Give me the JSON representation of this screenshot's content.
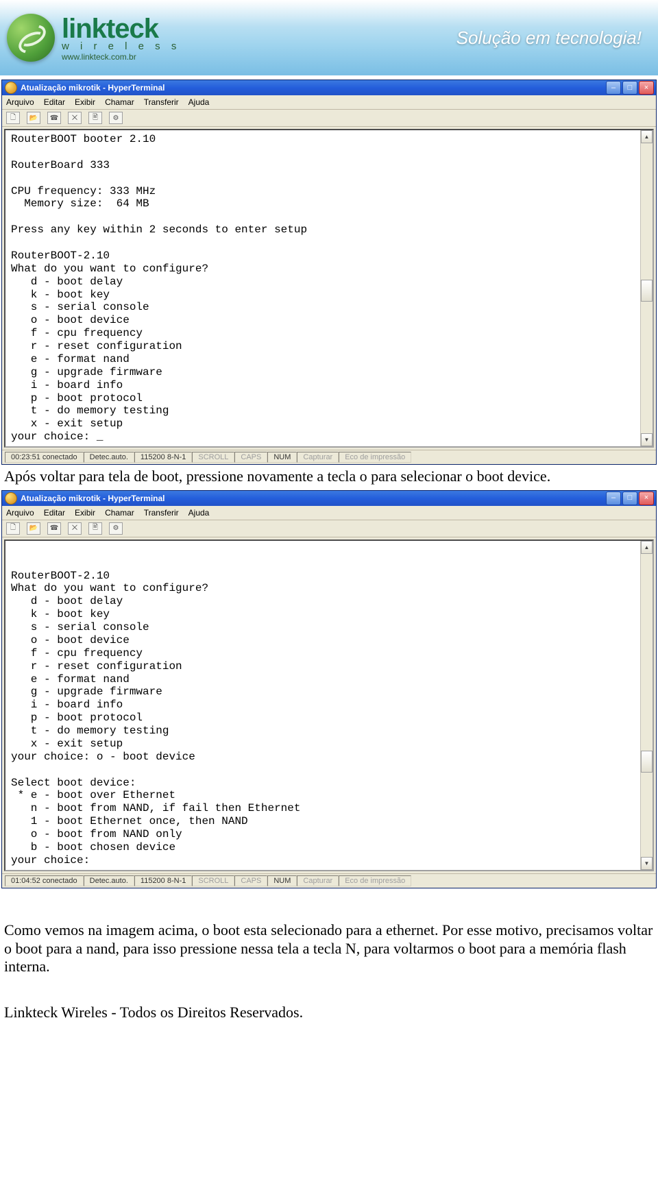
{
  "banner": {
    "brand": "linkteck",
    "sub": "w i r e l e s s",
    "url": "www.linkteck.com.br",
    "slogan": "Solução em tecnologia!"
  },
  "menu": {
    "items": [
      "Arquivo",
      "Editar",
      "Exibir",
      "Chamar",
      "Transferir",
      "Ajuda"
    ]
  },
  "window1": {
    "title": "Atualização mikrotik - HyperTerminal",
    "content": "RouterBOOT booter 2.10\n\nRouterBoard 333\n\nCPU frequency: 333 MHz\n  Memory size:  64 MB\n\nPress any key within 2 seconds to enter setup\n\nRouterBOOT-2.10\nWhat do you want to configure?\n   d - boot delay\n   k - boot key\n   s - serial console\n   o - boot device\n   f - cpu frequency\n   r - reset configuration\n   e - format nand\n   g - upgrade firmware\n   i - board info\n   p - boot protocol\n   t - do memory testing\n   x - exit setup\nyour choice: _",
    "status": {
      "time": "00:23:51 conectado",
      "detect": "Detec.auto.",
      "port": "115200 8-N-1",
      "scroll": "SCROLL",
      "caps": "CAPS",
      "num": "NUM",
      "capture": "Capturar",
      "echo": "Eco de impressão"
    },
    "thumb_top": "47%"
  },
  "para1": "Após voltar para tela de boot, pressione novamente a tecla o para selecionar o boot device.",
  "window2": {
    "title": "Atualização mikrotik - HyperTerminal",
    "content": "\n\nRouterBOOT-2.10\nWhat do you want to configure?\n   d - boot delay\n   k - boot key\n   s - serial console\n   o - boot device\n   f - cpu frequency\n   r - reset configuration\n   e - format nand\n   g - upgrade firmware\n   i - board info\n   p - boot protocol\n   t - do memory testing\n   x - exit setup\nyour choice: o - boot device\n\nSelect boot device:\n * e - boot over Ethernet\n   n - boot from NAND, if fail then Ethernet\n   1 - boot Ethernet once, then NAND\n   o - boot from NAND only\n   b - boot chosen device\nyour choice:",
    "status": {
      "time": "01:04:52 conectado",
      "detect": "Detec.auto.",
      "port": "115200 8-N-1",
      "scroll": "SCROLL",
      "caps": "CAPS",
      "num": "NUM",
      "capture": "Capturar",
      "echo": "Eco de impressão"
    },
    "thumb_top": "65%"
  },
  "para2": "Como vemos na imagem acima, o boot esta selecionado para a ethernet. Por esse motivo, precisamos voltar o boot para a nand, para isso pressione nessa tela a tecla N, para voltarmos o boot para a memória flash interna.",
  "footer": "Linkteck Wireles - Todos os Direitos Reservados."
}
